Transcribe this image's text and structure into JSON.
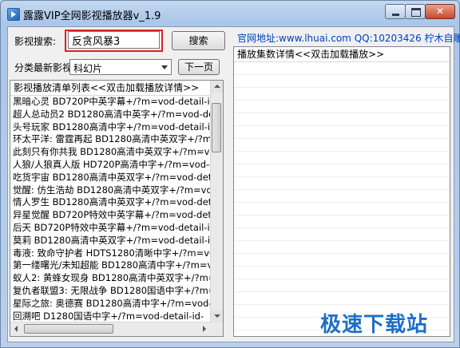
{
  "window": {
    "title": "露露VIP全网影视播放器v_1.9"
  },
  "search": {
    "label": "影视搜索:",
    "value": "反贪风暴3",
    "button": "搜索"
  },
  "category": {
    "label": "分类最新影视:",
    "selected": "科幻片",
    "next_button": "下一页"
  },
  "site_info": "官网地址:www.lhuai.com QQ:10203426 柠木自雕",
  "playlist": {
    "header": "影视播放清单列表<<双击加载播放详情>>",
    "items": [
      "黑暗心灵 BD720P中英字幕+/?m=vod-detail-id",
      "超人总动员2 BD1280高清中英字+/?m=vod-detail",
      "头号玩家 BD1280高清中字+/?m=vod-detail-id",
      "环太平洋: 雷霆再起 BD1280高清中英双字+/?m",
      "此刻只有你共我 BD1280高清中英双字+/?m=vod",
      "人狼/人狼真人版 HD720P高清中字+/?m=vod-det",
      "吃货宇宙 BD1280高清中英双字+/?m=vod-detail",
      "觉醒: 仿生浩劫 BD1280高清中英双字+/?m=vod-de",
      "情人罗生 BD1280高清中英双字+/?m=vod-detail-",
      "异星觉醒 BD720P特效中英字幕+/?m=vod-detail-",
      "后天 BD720P特效中英字幕+/?m=vod-detail-id-",
      "莫莉 BD1280高清中英双字+/?m=vod-detail-id-",
      "毒液: 致命守护者 HDTS1280清晰中字+/?m=vod",
      "第一缕曙光/未知超能 BD1280高清中字+/?m=vod",
      "蚁人2: 黄蜂女现身 BD1280高清中英双字+/?m=v",
      "复仇者联盟3: 无限战争 BD1280国语中字+/?m=vo",
      "星际之旅: 奥德赛 BD1280高清中字+/?m=vod-detail",
      "回溯吧 D1280国语中字+/?m=vod-detail-id-"
    ]
  },
  "detail": {
    "header": "播放集数详情<<双击加载播放>>"
  },
  "watermark": "极速下载站"
}
